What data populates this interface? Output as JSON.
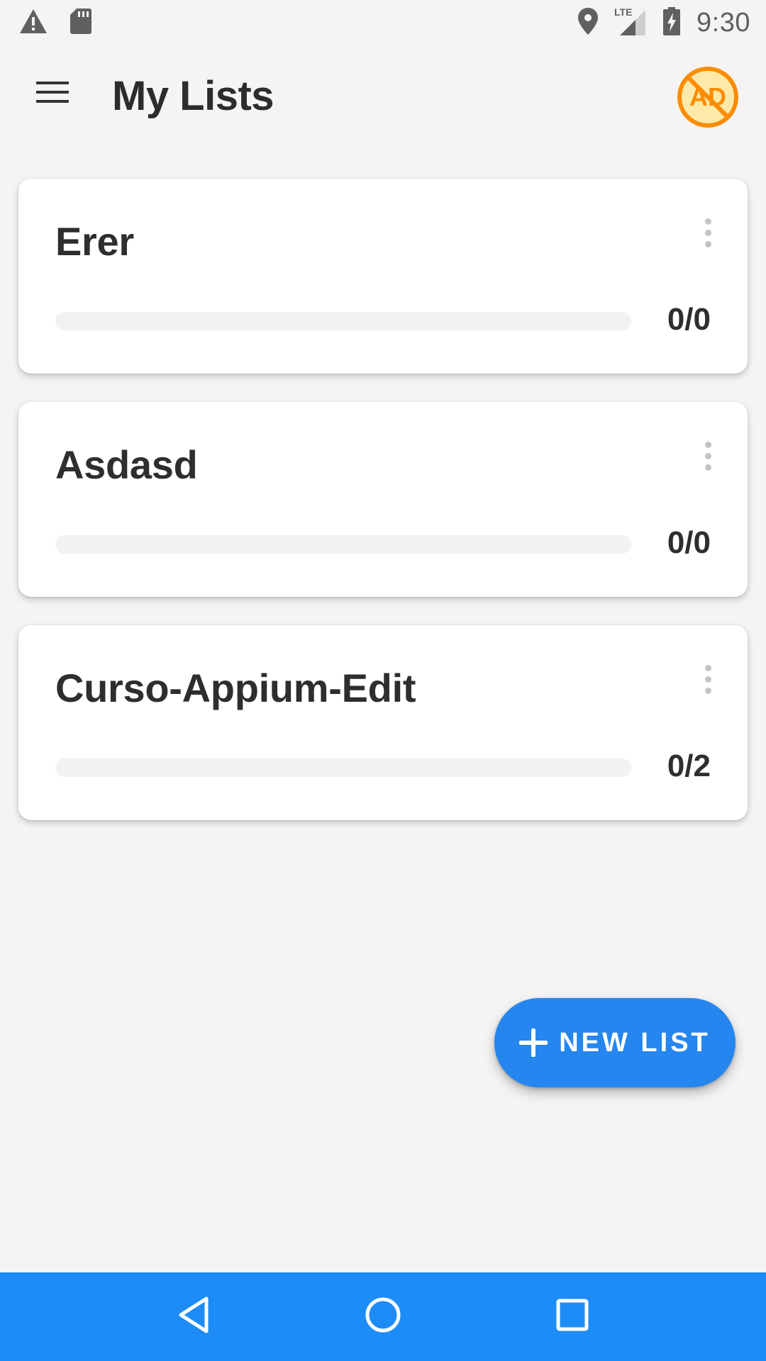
{
  "status_bar": {
    "time": "9:30",
    "network": "LTE",
    "icons": [
      "warning-icon",
      "sd-card-icon",
      "location-icon",
      "signal-icon",
      "battery-charging-icon"
    ]
  },
  "app_bar": {
    "title": "My Lists",
    "menu_icon": "hamburger-menu-icon",
    "ad_badge": "AD"
  },
  "lists": [
    {
      "name": "Erer",
      "count": "0/0",
      "progress": 0
    },
    {
      "name": "Asdasd",
      "count": "0/0",
      "progress": 0
    },
    {
      "name": "Curso-Appium-Edit",
      "count": "0/2",
      "progress": 0
    }
  ],
  "fab": {
    "label": "NEW LIST",
    "icon": "plus-icon"
  },
  "nav_bar": {
    "icons": [
      "back-icon",
      "home-icon",
      "recents-icon"
    ]
  },
  "colors": {
    "accent": "#2486ee",
    "nav_bar": "#1e8cf6",
    "ad_orange": "#fb8c00",
    "background": "#f4f4f4"
  }
}
